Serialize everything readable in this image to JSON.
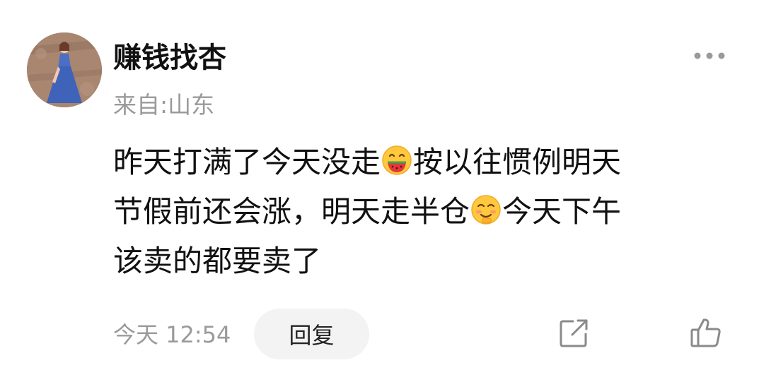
{
  "comment": {
    "author": "赚钱找杏",
    "location": "来自:山东",
    "lines": [
      [
        "昨天打满了今天没走",
        "按以往惯例明天"
      ],
      [
        "节假前还会涨，明天走半仓",
        "今天下午"
      ],
      [
        "该卖的都要卖了"
      ]
    ],
    "emojis": [
      "eating-watermelon-emoji",
      "shy-smile-emoji"
    ],
    "timestamp": "今天 12:54",
    "reply_label": "回复"
  },
  "icons": {
    "more": "more-dots-icon",
    "share": "share-icon",
    "like": "thumbs-up-icon"
  },
  "colors": {
    "text": "#111111",
    "secondary_text": "#9a9a9a",
    "reply_button_bg": "#f3f3f3",
    "icon": "#8a8a8a"
  }
}
